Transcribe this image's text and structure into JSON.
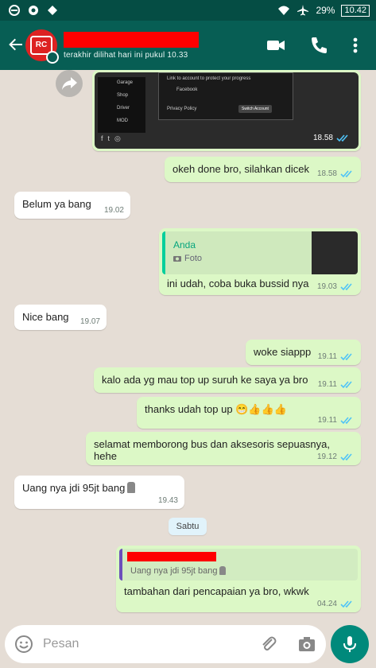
{
  "status_bar": {
    "battery": "29%",
    "time": "10.42"
  },
  "header": {
    "last_seen": "terakhir dilihat hari ini pukul 10.33",
    "avatar_text": "RC"
  },
  "image_message": {
    "time": "18.58",
    "link_text": "Link to account to protect your progress",
    "facebook": "Facebook",
    "privacy": "Privacy Policy",
    "switch": "Switch Account",
    "menu": [
      "Garage",
      "Shop",
      "Driver",
      "MOD"
    ]
  },
  "messages": [
    {
      "text": "okeh done bro, silahkan dicek",
      "time": "18.58"
    },
    {
      "text": "Belum ya bang",
      "time": "19.02"
    },
    {
      "quote_name": "Anda",
      "quote_type": "Foto",
      "text": "ini udah, coba buka bussid nya",
      "time": "19.03"
    },
    {
      "text": "Nice bang",
      "time": "19.07"
    },
    {
      "text": "woke siappp",
      "time": "19.11"
    },
    {
      "text": "kalo ada yg mau top up suruh ke saya ya bro",
      "time": "19.11"
    },
    {
      "text": "thanks udah top up 😁👍👍👍",
      "time": "19.11"
    },
    {
      "text": "selamat memborong bus dan aksesoris sepuasnya, hehe",
      "time": "19.12"
    },
    {
      "text": "Uang nya jdi 95jt bang",
      "time": "19.43"
    },
    {
      "quote_text": "Uang nya jdi 95jt bang",
      "text": "tambahan dari pencapaian ya bro, wkwk",
      "time": "04.24"
    }
  ],
  "day_separator": "Sabtu",
  "input": {
    "placeholder": "Pesan"
  }
}
